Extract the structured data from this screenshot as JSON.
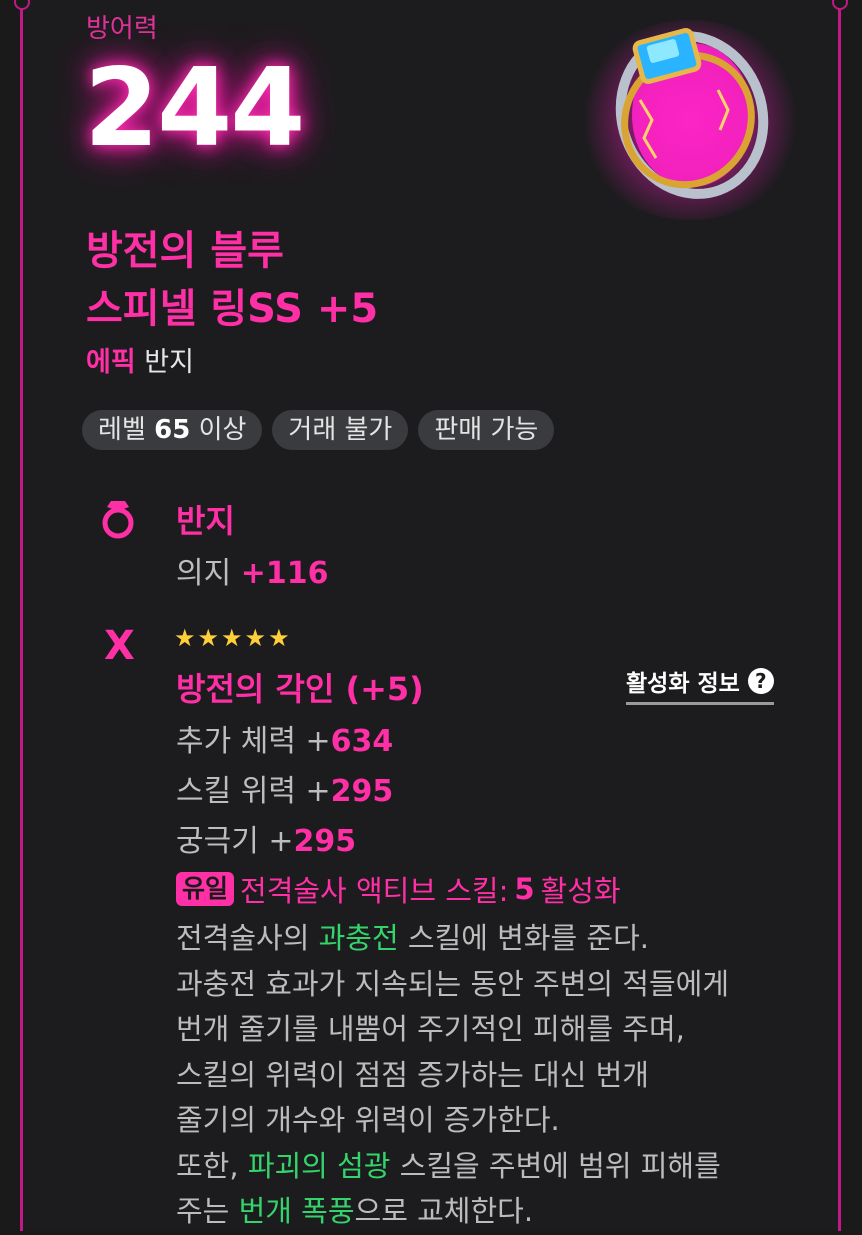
{
  "stat": {
    "label": "방어력",
    "value": "244"
  },
  "item": {
    "name_line1": "방전의 블루",
    "name_line2": "스피넬 링SS +5",
    "grade": "에픽",
    "type": "반지",
    "icon": "spinel-ring-art"
  },
  "tags": {
    "level_prefix": "레벨",
    "level_value": "65",
    "level_suffix": "이상",
    "trade": "거래 불가",
    "sell": "판매 가능"
  },
  "base": {
    "icon": "ring-icon",
    "title": "반지",
    "stat_name": "의지",
    "stat_value": "+116"
  },
  "engraving": {
    "icon": "crossed-swords-icon",
    "stars": "★★★★★",
    "star_count": 5,
    "title": "방전의 각인 (+5)",
    "activation_link": "활성화 정보",
    "stats": [
      {
        "name": "추가 체력 +",
        "value": "634"
      },
      {
        "name": "스킬 위력 +",
        "value": "295"
      },
      {
        "name": "궁극기 +",
        "value": "295"
      }
    ],
    "unique_badge": "유일",
    "unique_text": "전격술사 액티브 스킬:",
    "unique_count": "5",
    "unique_suffix": "활성화",
    "desc": {
      "l1_a": "전격술사의",
      "l1_hl": "과충전",
      "l1_b": "스킬에 변화를 준다.",
      "l2": "과충전 효과가 지속되는 동안 주변의 적들에게",
      "l3": "번개 줄기를 내뿜어 주기적인 피해를 주며,",
      "l4": "스킬의 위력이 점점 증가하는 대신 번개",
      "l5": "줄기의 개수와 위력이 증가한다.",
      "l6_a": "또한,",
      "l6_hl": "파괴의 섬광",
      "l6_b": "스킬을 주변에 범위 피해를",
      "l7_a": "주는",
      "l7_hl": "번개 폭풍",
      "l7_b": "으로 교체한다."
    }
  },
  "colors": {
    "accent": "#ff2fa6",
    "highlight": "#34d36b",
    "star": "#ffcf3a",
    "background": "#1c1c1e"
  }
}
